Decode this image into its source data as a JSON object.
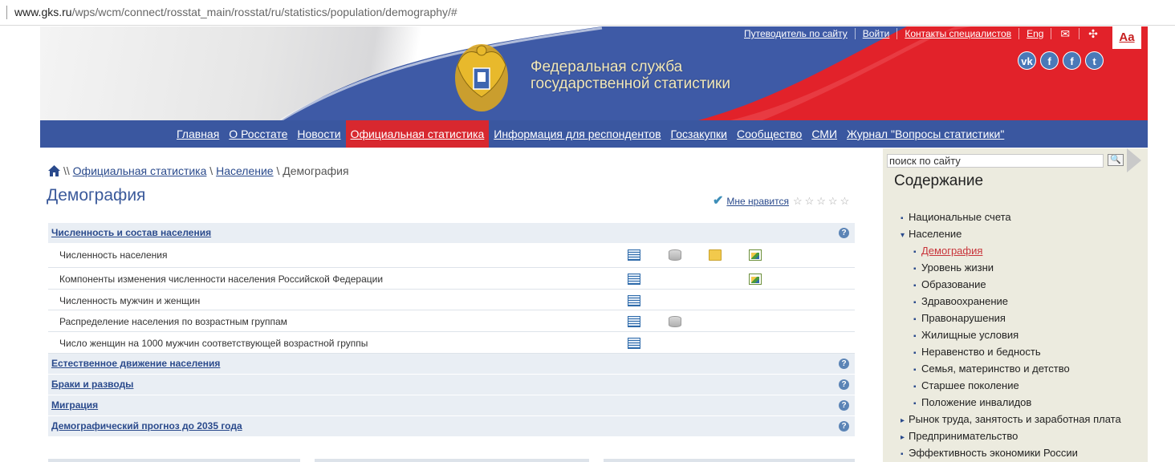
{
  "browser": {
    "url_host": "www.gks.ru",
    "url_path": "/wps/wcm/connect/rosstat_main/rosstat/ru/statistics/population/demography/#"
  },
  "header": {
    "title_line1": "Федеральная служба",
    "title_line2": "государственной статистики",
    "top_links": [
      "Путеводитель по сайту",
      "Войти",
      "Контакты специалистов",
      "Eng"
    ],
    "font_size_button": "Aa",
    "social": [
      "vk",
      "f",
      "f",
      "t"
    ]
  },
  "nav": {
    "items": [
      "Главная",
      "О Росстате",
      "Новости",
      "Официальная статистика",
      "Информация для респондентов",
      "Госзакупки",
      "Сообщество",
      "СМИ",
      "Журнал \"Вопросы статистики\""
    ],
    "active_index": 3
  },
  "breadcrumb": {
    "sep_start": "\\\\",
    "items": [
      "Официальная статистика",
      "Население"
    ],
    "current": "Демография",
    "sep": "\\"
  },
  "page": {
    "title": "Демография",
    "like_label": "Мне нравится",
    "stars": "☆☆☆☆☆",
    "help": "?"
  },
  "content": {
    "sections": [
      {
        "title": "Численность и состав населения",
        "rows": [
          {
            "label": "Численность населения",
            "icons": [
              "table",
              "database",
              "folder",
              "chart"
            ]
          },
          {
            "label": "Компоненты изменения численности населения Российской Федерации",
            "icons": [
              "table",
              "",
              "",
              "chart"
            ]
          },
          {
            "label": "Численность мужчин и женщин",
            "icons": [
              "table",
              "",
              "",
              ""
            ]
          },
          {
            "label": "Распределение населения по возрастным группам",
            "icons": [
              "table",
              "database",
              "",
              ""
            ]
          },
          {
            "label": "Число женщин на 1000 мужчин соответствующей возрастной группы",
            "icons": [
              "table",
              "",
              "",
              ""
            ]
          }
        ]
      },
      {
        "title": "Естественное движение населения",
        "rows": []
      },
      {
        "title": "Браки и разводы",
        "rows": []
      },
      {
        "title": "Миграция",
        "rows": []
      },
      {
        "title": "Демографический прогноз до 2035 года",
        "rows": []
      }
    ]
  },
  "sidebar": {
    "search_value": "поиск по сайту",
    "search_button_icon": "magnifier-icon",
    "title": "Содержание",
    "items": [
      {
        "label": "Национальные счета",
        "level": 0,
        "marker": "▪"
      },
      {
        "label": "Население",
        "level": 0,
        "marker": "▾"
      },
      {
        "label": "Демография",
        "level": 1,
        "marker": "▪",
        "current": true
      },
      {
        "label": "Уровень жизни",
        "level": 1,
        "marker": "▪"
      },
      {
        "label": "Образование",
        "level": 1,
        "marker": "▪"
      },
      {
        "label": "Здравоохранение",
        "level": 1,
        "marker": "▪"
      },
      {
        "label": "Правонарушения",
        "level": 1,
        "marker": "▪"
      },
      {
        "label": "Жилищные условия",
        "level": 1,
        "marker": "▪"
      },
      {
        "label": "Неравенство и бедность",
        "level": 1,
        "marker": "▪"
      },
      {
        "label": "Семья, материнство и детство",
        "level": 1,
        "marker": "▪"
      },
      {
        "label": "Старшее поколение",
        "level": 1,
        "marker": "▪"
      },
      {
        "label": "Положение инвалидов",
        "level": 1,
        "marker": "▪"
      },
      {
        "label": "Рынок труда, занятость и заработная плата",
        "level": 0,
        "marker": "▸"
      },
      {
        "label": "Предпринимательство",
        "level": 0,
        "marker": "▸"
      },
      {
        "label": "Эффективность экономики России",
        "level": 0,
        "marker": "▪"
      }
    ]
  },
  "colors": {
    "nav_bg": "#3a57a0",
    "nav_active": "#d8282f",
    "link": "#2a4a8c",
    "sidebar_bg": "#ecebdf",
    "section_bg": "#e9eef4"
  }
}
